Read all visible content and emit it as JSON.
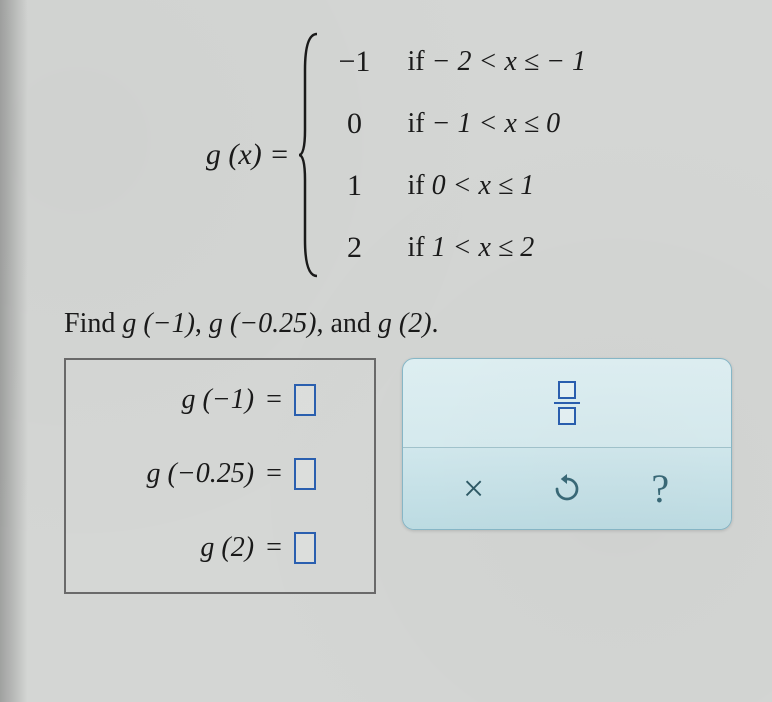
{
  "piecewise": {
    "lhs": "g (x) =",
    "cases": [
      {
        "value": "−1",
        "if": "if",
        "cond": " − 2 < x ≤ − 1"
      },
      {
        "value": "0",
        "if": "if",
        "cond": " − 1 < x ≤ 0"
      },
      {
        "value": "1",
        "if": "if",
        "cond": " 0 < x ≤ 1"
      },
      {
        "value": "2",
        "if": "if",
        "cond": " 1 < x ≤ 2"
      }
    ]
  },
  "instruction": {
    "prefix": "Find ",
    "g1": "g (−1)",
    "sep1": ", ",
    "g2": "g (−0.25)",
    "sep2": ", and ",
    "g3": "g (2)",
    "suffix": "."
  },
  "answers": [
    {
      "label": "g (−1)",
      "eq": "="
    },
    {
      "label": "g (−0.25)",
      "eq": "="
    },
    {
      "label": "g (2)",
      "eq": "="
    }
  ],
  "toolbar": {
    "fraction_tool": "fraction",
    "clear": "×",
    "reset": "reset",
    "help": "?"
  }
}
